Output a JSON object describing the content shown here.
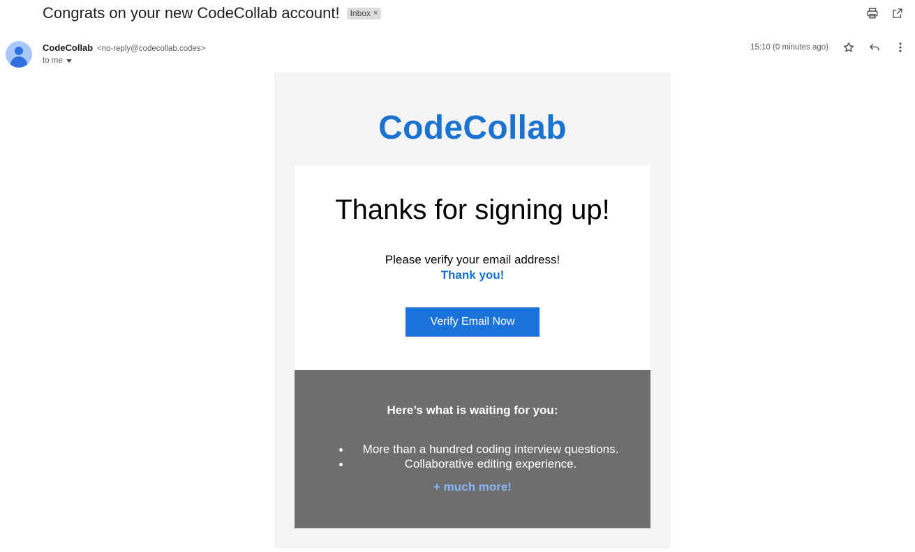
{
  "email": {
    "subject": "Congrats on your new CodeCollab account!",
    "label": "Inbox",
    "label_remove": "×",
    "sender_name": "CodeCollab",
    "sender_email": "<no-reply@codecollab.codes>",
    "recipient": "to me",
    "time": "15:10 (0 minutes ago)"
  },
  "icons": {
    "print": "print-icon",
    "open_new_window": "open-in-new-window-icon",
    "star": "star-icon",
    "reply": "reply-icon",
    "more": "more-vertical-icon",
    "avatar": "avatar-icon"
  },
  "body": {
    "brand": "CodeCollab",
    "headline": "Thanks for signing up!",
    "verify_message": "Please verify your email address!",
    "thank_you": "Thank you!",
    "cta_label": "Verify Email Now",
    "footer_title": "Here’s what is waiting for you:",
    "features": [
      "More than a hundred coding interview questions.",
      "Collaborative editing experience."
    ],
    "more_link": "+ much more!"
  },
  "colors": {
    "brand_blue": "#1a73d0",
    "button_blue": "#1a73d8",
    "footer_gray": "#6e6e6e",
    "outer_bg": "#f4f4f4",
    "more_link": "#8ab4f8"
  }
}
